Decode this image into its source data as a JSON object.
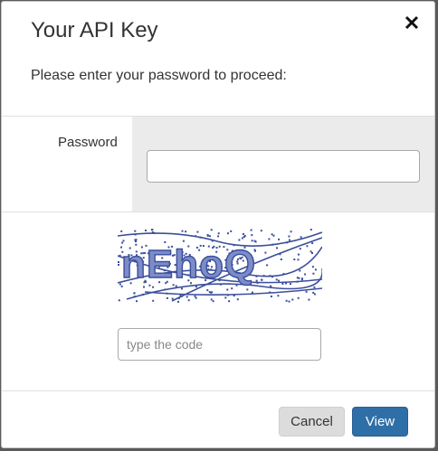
{
  "modal": {
    "title": "Your API Key",
    "prompt": "Please enter your password to proceed:",
    "close_icon": "close-icon"
  },
  "password": {
    "label": "Password",
    "value": ""
  },
  "captcha": {
    "text": "nEhoQ",
    "color": "#3b4f9c"
  },
  "code_input": {
    "placeholder": "type the code",
    "value": ""
  },
  "buttons": {
    "cancel_label": "Cancel",
    "view_label": "View",
    "view_color": "#2f6fa7"
  }
}
